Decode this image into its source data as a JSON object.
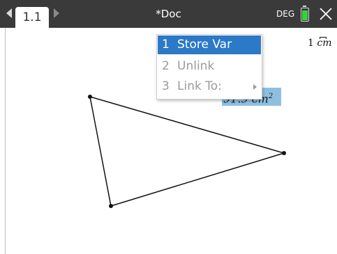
{
  "topbar": {
    "tab_label": "1.1",
    "doc_title": "*Doc",
    "angle_mode": "DEG",
    "battery_level": 0.9
  },
  "canvas": {
    "measurement_value": "91.9",
    "measurement_unit": "cm",
    "measurement_exp": "2",
    "scale_value": "1",
    "scale_unit": "cm"
  },
  "context_menu": {
    "items": [
      {
        "num": "1",
        "label": "Store Var",
        "state": "selected"
      },
      {
        "num": "2",
        "label": "Unlink",
        "state": "disabled"
      },
      {
        "num": "3",
        "label": "Link To:",
        "state": "disabled",
        "has_submenu": true
      }
    ]
  },
  "colors": {
    "topbar": "#3a3a3a",
    "menu_highlight": "#2c79c7",
    "measure_highlight": "#8fbfe0",
    "battery": "#35d23a"
  }
}
